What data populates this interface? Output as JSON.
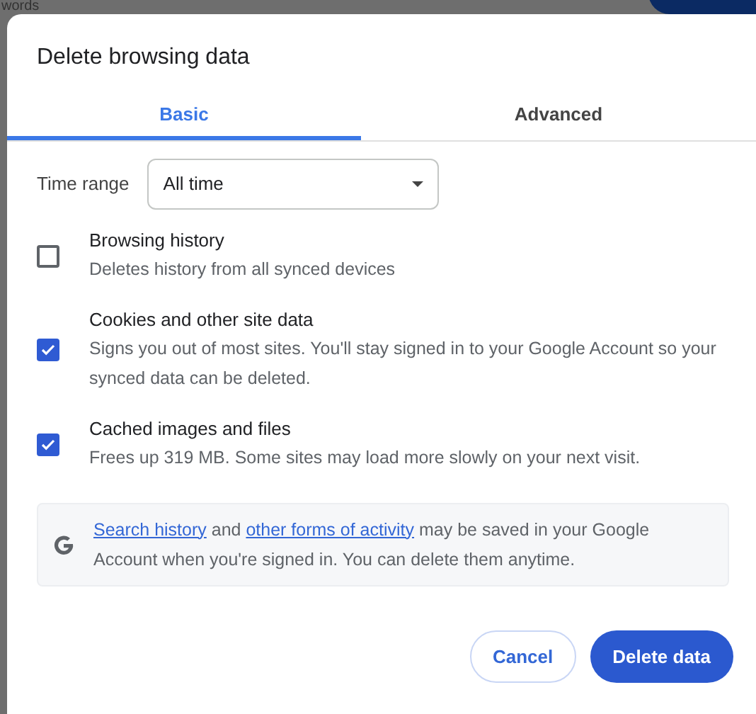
{
  "background": {
    "text": "words"
  },
  "dialog": {
    "title": "Delete browsing data",
    "tabs": [
      {
        "label": "Basic",
        "selected": true
      },
      {
        "label": "Advanced",
        "selected": false
      }
    ],
    "time_range": {
      "label": "Time range",
      "value": "All time"
    },
    "options": [
      {
        "label": "Browsing history",
        "description": "Deletes history from all synced devices",
        "checked": false
      },
      {
        "label": "Cookies and other site data",
        "description": "Signs you out of most sites. You'll stay signed in to your Google Account so your synced data can be deleted.",
        "checked": true
      },
      {
        "label": "Cached images and files",
        "description": "Frees up 319 MB. Some sites may load more slowly on your next visit.",
        "checked": true
      }
    ],
    "info": {
      "link_1": "Search history",
      "text_1": "and",
      "link_2": "other forms of activity",
      "text_2": "may be saved in your Google Account when you're signed in. You can delete them anytime."
    },
    "buttons": [
      {
        "label": "Cancel",
        "kind": "secondary"
      },
      {
        "label": "Delete data",
        "kind": "primary"
      }
    ]
  }
}
